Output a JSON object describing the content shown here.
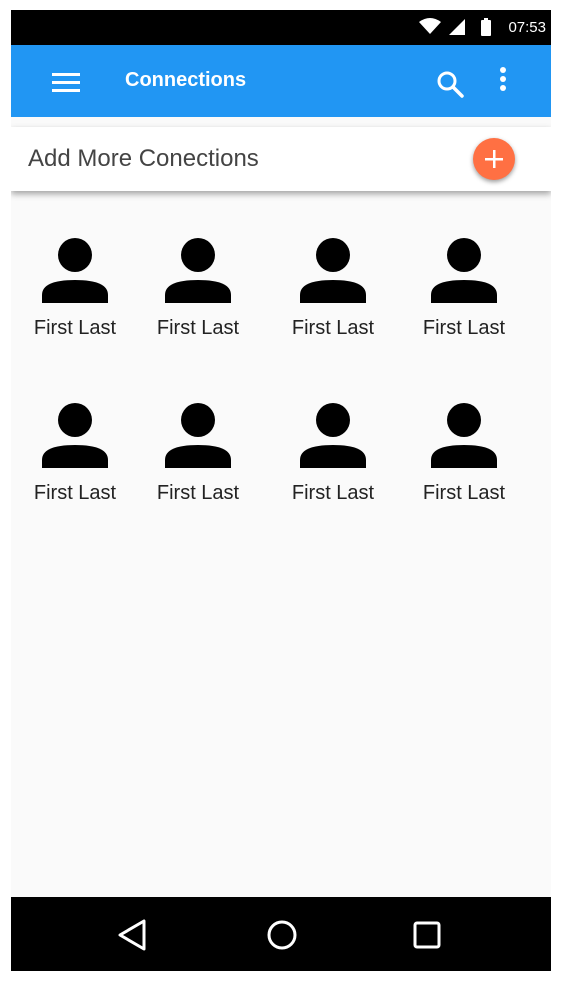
{
  "status_bar": {
    "time": "07:53",
    "icons": [
      "wifi-icon",
      "cell-signal-icon",
      "battery-icon"
    ]
  },
  "app_bar": {
    "title": "Connections",
    "color": "#2196F3",
    "actions": [
      "menu-icon",
      "search-icon",
      "more-vert-icon"
    ]
  },
  "add_card": {
    "label": "Add More Conections",
    "fab_icon": "plus-icon",
    "fab_color": "#FF7043"
  },
  "contacts": [
    {
      "name": "First Last",
      "icon": "person-icon"
    },
    {
      "name": "First Last",
      "icon": "person-icon"
    },
    {
      "name": "First Last",
      "icon": "person-icon"
    },
    {
      "name": "First Last",
      "icon": "person-icon"
    },
    {
      "name": "First Last",
      "icon": "person-icon"
    },
    {
      "name": "First Last",
      "icon": "person-icon"
    },
    {
      "name": "First Last",
      "icon": "person-icon"
    },
    {
      "name": "First Last",
      "icon": "person-icon"
    }
  ],
  "nav_bar": {
    "buttons": [
      "back-icon",
      "home-icon",
      "recents-icon"
    ]
  }
}
